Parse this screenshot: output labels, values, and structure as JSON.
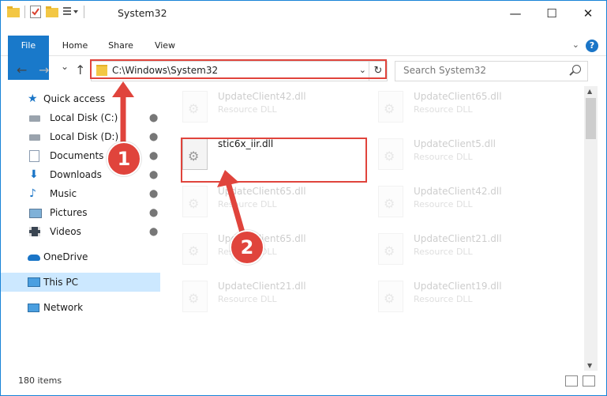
{
  "window": {
    "title": "System32",
    "minimize": "—",
    "maximize": "☐",
    "close": "✕"
  },
  "ribbon": {
    "tabs": [
      "File",
      "Home",
      "Share",
      "View"
    ],
    "help": "?"
  },
  "nav": {
    "back": "←",
    "forward": "→",
    "recent": "⌄",
    "up": "↑",
    "address": "C:\\Windows\\System32",
    "search_placeholder": "Search System32"
  },
  "sidebar": {
    "items": [
      {
        "label": "Quick access",
        "icon": "star-icon",
        "pinned": false
      },
      {
        "label": "Local Disk (C:)",
        "icon": "drive-icon",
        "pinned": true
      },
      {
        "label": "Local Disk (D:)",
        "icon": "drive-icon",
        "pinned": true
      },
      {
        "label": "Documents",
        "icon": "documents-icon",
        "pinned": true
      },
      {
        "label": "Downloads",
        "icon": "downloads-icon",
        "pinned": true
      },
      {
        "label": "Music",
        "icon": "music-icon",
        "pinned": true
      },
      {
        "label": "Pictures",
        "icon": "pictures-icon",
        "pinned": true
      },
      {
        "label": "Videos",
        "icon": "videos-icon",
        "pinned": true
      },
      {
        "label": "OneDrive",
        "icon": "cloud-icon",
        "pinned": false
      },
      {
        "label": "This PC",
        "icon": "computer-icon",
        "pinned": false
      },
      {
        "label": "Network",
        "icon": "network-icon",
        "pinned": false
      }
    ],
    "pin_glyph": "📌"
  },
  "files": [
    {
      "name": "UpdateClient42.dll",
      "type": "Resource DLL",
      "faded": true
    },
    {
      "name": "UpdateClient65.dll",
      "type": "Resource DLL",
      "faded": true
    },
    {
      "name": "stic6x_iir.dll",
      "type": "",
      "faded": false
    },
    {
      "name": "UpdateClient5.dll",
      "type": "Resource DLL",
      "faded": true
    },
    {
      "name": "UpdateClient65.dll",
      "type": "Resource DLL",
      "faded": true
    },
    {
      "name": "UpdateClient42.dll",
      "type": "Resource DLL",
      "faded": true
    },
    {
      "name": "UpdateClient65.dll",
      "type": "Resource DLL",
      "faded": true
    },
    {
      "name": "UpdateClient21.dll",
      "type": "Resource DLL",
      "faded": true
    },
    {
      "name": "UpdateClient21.dll",
      "type": "Resource DLL",
      "faded": true
    },
    {
      "name": "UpdateClient19.dll",
      "type": "Resource DLL",
      "faded": true
    }
  ],
  "status": {
    "item_count": "180 items"
  },
  "annotations": {
    "step1": "1",
    "step2": "2",
    "color": "#e0443c"
  }
}
